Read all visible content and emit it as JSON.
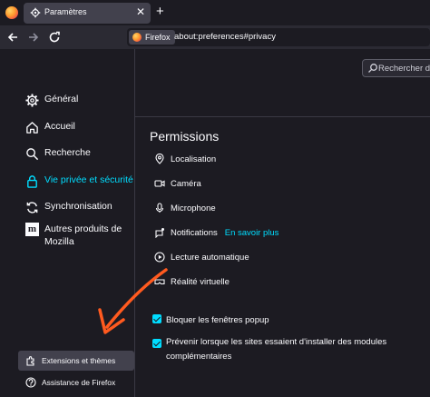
{
  "browser": {
    "tab_label": "Paramètres",
    "new_tab_glyph": "+",
    "close_glyph": "✕",
    "identity_label": "Firefox",
    "url": "about:preferences#privacy"
  },
  "search": {
    "placeholder": "Rechercher dans les paramètres"
  },
  "sidebar": {
    "items": [
      {
        "label": "Général",
        "icon": "gear-icon"
      },
      {
        "label": "Accueil",
        "icon": "home-icon"
      },
      {
        "label": "Recherche",
        "icon": "search-icon"
      },
      {
        "label": "Vie privée et sécurité",
        "icon": "lock-icon",
        "active": true
      },
      {
        "label": "Synchronisation",
        "icon": "sync-icon"
      },
      {
        "label": "Autres produits de Mozilla",
        "icon": "mozilla-icon"
      }
    ],
    "bottom": [
      {
        "label": "Extensions et thèmes",
        "icon": "puzzle-icon",
        "highlighted": true
      },
      {
        "label": "Assistance de Firefox",
        "icon": "help-icon"
      }
    ],
    "mozilla_glyph": "m"
  },
  "permissions": {
    "title": "Permissions",
    "items": [
      {
        "label": "Localisation",
        "icon": "location-icon"
      },
      {
        "label": "Caméra",
        "icon": "camera-icon"
      },
      {
        "label": "Microphone",
        "icon": "microphone-icon"
      },
      {
        "label": "Notifications",
        "icon": "notification-icon",
        "link": "En savoir plus"
      },
      {
        "label": "Lecture automatique",
        "icon": "autoplay-icon"
      },
      {
        "label": "Réalité virtuelle",
        "icon": "vr-icon"
      }
    ],
    "checkboxes": [
      {
        "label": "Bloquer les fenêtres popup",
        "checked": true
      },
      {
        "label": "Prévenir lorsque les sites essaient d'installer des modules complémentaires",
        "checked": true
      }
    ]
  },
  "colors": {
    "accent": "#00ddff",
    "annotation_arrow": "#ff5a1f",
    "background": "#1c1b22"
  }
}
